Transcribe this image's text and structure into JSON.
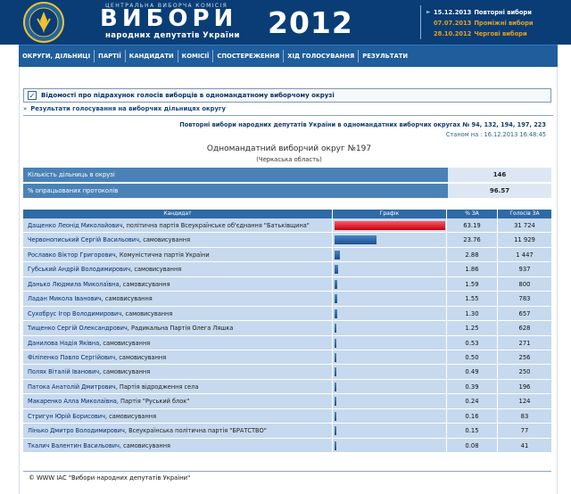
{
  "header": {
    "cvk": "ЦЕНТРАЛЬНА ВИБОРЧА КОМІСІЯ",
    "title": "ВИБОРИ",
    "subtitle": "народних депутатів України",
    "year": "2012"
  },
  "news": [
    {
      "date": "15.12.2013",
      "title": "Повторні вибори",
      "color": "#ffffff"
    },
    {
      "date": "07.07.2013",
      "title": "Проміжні вибори",
      "color": "#e2a122"
    },
    {
      "date": "28.10.2012",
      "title": "Чергові вибори",
      "color": "#e2a122"
    }
  ],
  "nav": [
    "ОКРУГИ, ДІЛЬНИЦІ",
    "ПАРТІЇ",
    "КАНДИДАТИ",
    "КОМІСІЇ",
    "СПОСТЕРЕЖЕННЯ",
    "ХІД ГОЛОСУВАННЯ",
    "РЕЗУЛЬТАТИ"
  ],
  "content": {
    "doc_title": "Відомості про підрахунок голосів виборців в одномандатному виборчому окрузі",
    "breadcrumb": "Результати голосування на виборчих дільницях округу",
    "rerun_title": "Повторні вибори народних депутатів України в одномандатних виборчих округах № 94, 132, 194, 197, 223",
    "status": "Станом на : 16.12.2013 16:48:45",
    "district_title": "Одномандатний виборчий округ №197",
    "district_region": "(Черкаська область)",
    "stats": [
      {
        "label": "Кількість дільниць в окрузі",
        "value": "146"
      },
      {
        "label": "% опрацьованих протоколів",
        "value": "96.57"
      }
    ]
  },
  "table": {
    "headers": [
      "Кандидат",
      "Графік",
      "% ЗА",
      "Голосів ЗА"
    ],
    "rows": [
      {
        "name": "Дащенко Леонід Миколайович",
        "party": ", політична партія Всеукраїнське об'єднання \"Батьківщина\"",
        "pct": "63.19",
        "votes": "31 724",
        "share": 0.6319,
        "color": "red"
      },
      {
        "name": "Червонописький Сергій Васильович",
        "party": ", самовисування",
        "pct": "23.76",
        "votes": "11 929",
        "share": 0.2376,
        "color": "blue"
      },
      {
        "name": "Рославко Віктор Григорович",
        "party": ", Комуністична партія України",
        "pct": "2.88",
        "votes": "1 447",
        "share": 0.0288,
        "color": "blue"
      },
      {
        "name": "Губський Андрій Володимирович",
        "party": ", самовисування",
        "pct": "1.86",
        "votes": "937",
        "share": 0.0186,
        "color": "blue"
      },
      {
        "name": "Данько Людмила Миколаївна",
        "party": ", самовисування",
        "pct": "1.59",
        "votes": "800",
        "share": 0.0159,
        "color": "blue"
      },
      {
        "name": "Ладан Микола Іванович",
        "party": ", самовисування",
        "pct": "1.55",
        "votes": "783",
        "share": 0.0155,
        "color": "blue"
      },
      {
        "name": "Сухобрус Ігор Володимирович",
        "party": ", самовисування",
        "pct": "1.30",
        "votes": "657",
        "share": 0.013,
        "color": "blue"
      },
      {
        "name": "Тищенко Сергій Олександрович",
        "party": ", Радикальна Партія Олега Ляшка",
        "pct": "1.25",
        "votes": "628",
        "share": 0.0125,
        "color": "blue"
      },
      {
        "name": "Данилова Надія Яківна",
        "party": ", самовисування",
        "pct": "0.53",
        "votes": "271",
        "share": 0.0053,
        "color": "blue"
      },
      {
        "name": "Філіпенко Павло Сергійович",
        "party": ", самовисування",
        "pct": "0.50",
        "votes": "256",
        "share": 0.005,
        "color": "blue"
      },
      {
        "name": "Полях Віталій Іванович",
        "party": ", самовисування",
        "pct": "0.49",
        "votes": "250",
        "share": 0.0049,
        "color": "blue"
      },
      {
        "name": "Патока Анатолій Дмитрович",
        "party": ", Партія відродження села",
        "pct": "0.39",
        "votes": "196",
        "share": 0.0039,
        "color": "blue"
      },
      {
        "name": "Макаренко Алла Миколаївна",
        "party": ", Партія \"Руський блок\"",
        "pct": "0.24",
        "votes": "124",
        "share": 0.0024,
        "color": "blue"
      },
      {
        "name": "Стригун Юрій Борисович",
        "party": ", самовисування",
        "pct": "0.16",
        "votes": "83",
        "share": 0.0016,
        "color": "blue"
      },
      {
        "name": "Лінько Дмитро Володимирович",
        "party": ", Всеукраїнська політична партія \"БРАТСТВО\"",
        "pct": "0.15",
        "votes": "77",
        "share": 0.0015,
        "color": "blue"
      },
      {
        "name": "Ткалич Валентин Васильович",
        "party": ", самовисування",
        "pct": "0.08",
        "votes": "41",
        "share": 0.0008,
        "color": "blue"
      }
    ]
  },
  "footer": "© WWW ІАС \"Вибори народних депутатів України\""
}
